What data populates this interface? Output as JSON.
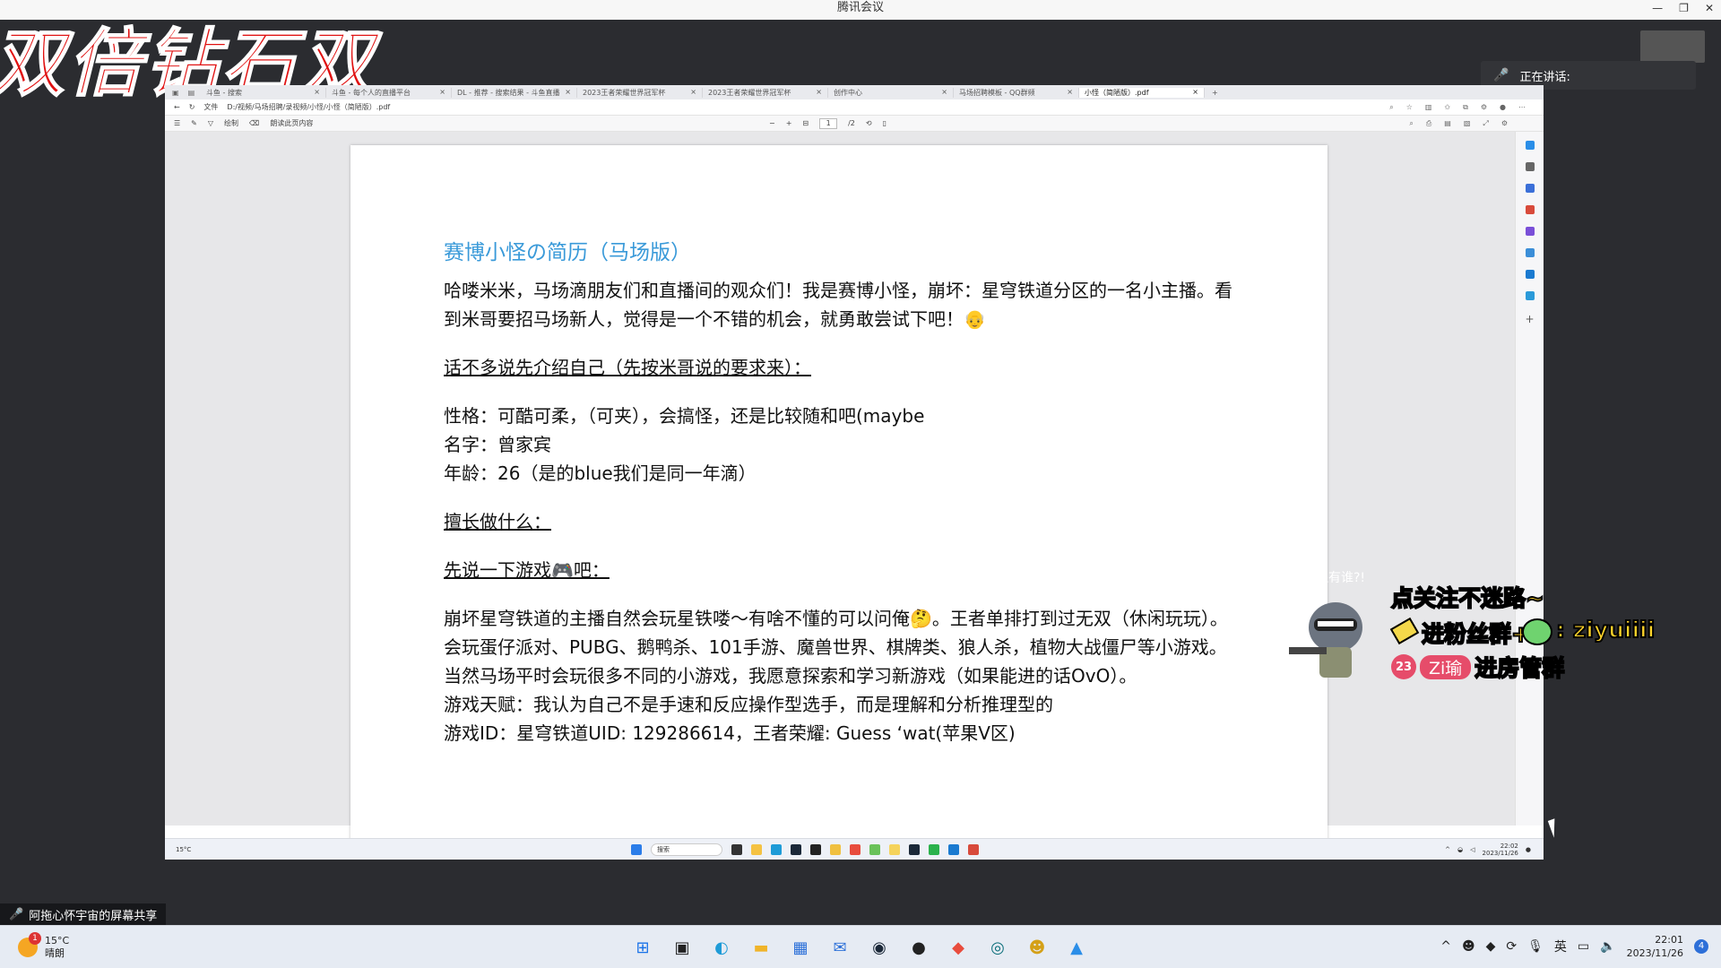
{
  "meeting": {
    "title": "腾讯会议",
    "speaking_label": "正在讲话:",
    "share_label": "阿拖心怀宇宙的屏幕共享"
  },
  "overlay_text": "双倍钻石双",
  "browser": {
    "tabs": [
      "斗鱼 - 搜索",
      "斗鱼 - 每个人的直播平台",
      "DL - 推荐 - 搜索结果 - 斗鱼直播",
      "2023王者荣耀世界冠军杯",
      "2023王者荣耀世界冠军杯",
      "创作中心",
      "马场招聘模板 - QQ群频",
      "小怪（简陋版）.pdf"
    ],
    "address_prefix": "文件",
    "address": "D:/视频/马场招聘/录视频/小怪/小怪（简陋版）.pdf",
    "toolbar_draw": "绘制",
    "toolbar_read": "朗读此页内容",
    "page_current": "1",
    "page_total": "/2"
  },
  "doc": {
    "title": "赛博小怪の简历（马场版）",
    "intro": "哈喽米米，马场滴朋友们和直播间的观众们！我是赛博小怪，崩坏：星穹铁道分区的一名小主播。看到米哥要招马场新人，觉得是一个不错的机会，就勇敢尝试下吧！👴",
    "section1": "话不多说先介绍自己（先按米哥说的要求来）：",
    "personality": "性格：可酷可柔，（可夹），会搞怪，还是比较随和吧(maybe",
    "name": "名字：曾家宾",
    "age": "年龄：26（是的blue我们是同一年滴）",
    "section2": "擅长做什么：",
    "section3": "先说一下游戏🎮吧：",
    "games": "崩坏星穹铁道的主播自然会玩星铁喽～有啥不懂的可以问俺🤔。王者单排打到过无双（休闲玩玩）。会玩蛋仔派对、PUBG、鹅鸭杀、101手游、魔兽世界、棋牌类、狼人杀，植物大战僵尸等小游戏。当然马场平时会玩很多不同的小游戏，我愿意探索和学习新游戏（如果能进的话OvO）。",
    "talent": "游戏天赋：我认为自己不是手速和反应操作型选手，而是理解和分析推理型的",
    "game_id": "游戏ID：星穹铁道UID: 129286614，王者荣耀: Guess ‘wat(苹果V区)"
  },
  "stream_widget": {
    "who": "还有谁?!",
    "line1": "点关注不迷路~",
    "line2": "进粉丝群+",
    "line2_id": ": ziyuiiii",
    "badge_num": "23",
    "pill": "Zi瑜",
    "line3": "进房管群"
  },
  "remote_taskbar": {
    "weather": "15°C",
    "search": "搜索",
    "time": "22:02",
    "date": "2023/11/26"
  },
  "taskbar": {
    "temp": "15°C",
    "condition": "晴朗",
    "badge": "1",
    "ime": "英",
    "time": "22:01",
    "date": "2023/11/26",
    "notif": "4"
  },
  "colors": {
    "doc_title": "#3a9ad9",
    "overlay_red": "#e01010",
    "widget_yellow": "#ffd42a"
  }
}
